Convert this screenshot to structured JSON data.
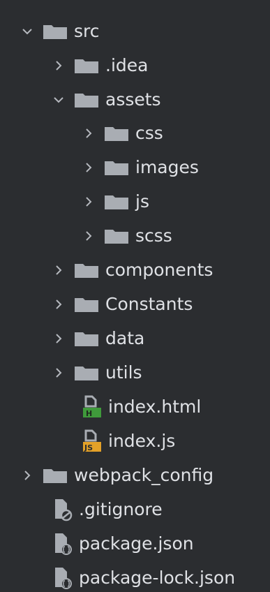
{
  "colors": {
    "background": "#2b2d30",
    "text": "#dfe1e5",
    "folder": "#a9adb3",
    "html_badge": "#3f9a3b",
    "js_badge": "#e4a128"
  },
  "tree": {
    "src": "src",
    "idea": ".idea",
    "assets": "assets",
    "css": "css",
    "images": "images",
    "js": "js",
    "scss": "scss",
    "components": "components",
    "constants": "Constants",
    "data": "data",
    "utils": "utils",
    "index_html": "index.html",
    "index_html_badge": "H",
    "index_js": "index.js",
    "index_js_badge": "JS",
    "webpack_config": "webpack_config",
    "gitignore": ".gitignore",
    "package_json": "package.json",
    "package_lock_json": "package-lock.json"
  },
  "icons": {
    "expanded": "chevron-down-icon",
    "collapsed": "chevron-right-icon",
    "folder": "folder-icon",
    "html_file": "html-file-icon",
    "js_file": "js-file-icon",
    "ignore_file": "ignore-file-icon",
    "json_file": "json-file-icon"
  }
}
